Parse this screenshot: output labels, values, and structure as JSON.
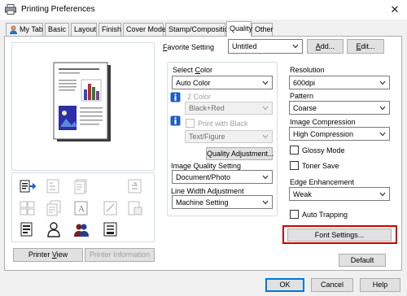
{
  "window": {
    "title": "Printing Preferences",
    "close_glyph": "✕"
  },
  "tabs": [
    {
      "label": "My Tab",
      "icon": "user-icon"
    },
    {
      "label": "Basic"
    },
    {
      "label": "Layout"
    },
    {
      "label": "Finish"
    },
    {
      "label": "Cover Mode"
    },
    {
      "label": "Stamp/Composition"
    },
    {
      "label": "Quality",
      "active": true
    },
    {
      "label": "Other"
    }
  ],
  "favorite": {
    "label_first": "F",
    "label_rest": "avorite Setting",
    "value": "Untitled",
    "add_first": "A",
    "add_rest": "dd...",
    "edit_first": "E",
    "edit_rest": "dit..."
  },
  "left_panel": {
    "preview_icons": [
      "printer-output-icon",
      "staple-icon",
      "booklet-icon",
      "stamp-icon",
      "grid-pages-icon",
      "copies-icon",
      "text-page-icon",
      "watermark-icon",
      "page-overlay-icon",
      "document-icon",
      "tray-icon",
      "color-icon",
      "user-auth-icon",
      "account-icon",
      "finisher-icon"
    ],
    "printer_view_first": "Printer ",
    "printer_view_u": "V",
    "printer_view_rest": "iew",
    "printer_info_label": "Printer Information"
  },
  "quality": {
    "select_color_label_pre": "Select ",
    "select_color_label_u": "C",
    "select_color_label_rest": "olor",
    "select_color_value": "Auto Color",
    "two_color_label": "2 Color",
    "two_color_value": "Black+Red",
    "print_with_black_label": "Print with Black",
    "print_with_black_value": "Text/Figure",
    "quality_adjustment_label": "Quality Adjustment...",
    "image_quality_label": "Image Quality Setting",
    "image_quality_value": "Document/Photo",
    "line_width_label": "Line Width Adjustment",
    "line_width_value": "Machine Setting"
  },
  "right_settings": {
    "resolution_label": "Resolution",
    "resolution_value": "600dpi",
    "pattern_label": "Pattern",
    "pattern_value": "Coarse",
    "compression_label": "Image Compression",
    "compression_value": "High Compression",
    "glossy_label": "Glossy Mode",
    "toner_save_label": "Toner Save",
    "edge_label": "Edge Enhancement",
    "edge_value": "Weak",
    "auto_trapping_label": "Auto Trapping",
    "font_settings_label": "Font Settings...",
    "default_label": "Default"
  },
  "footer": {
    "ok": "OK",
    "cancel": "Cancel",
    "help": "Help"
  },
  "colors": {
    "highlight": "#cc0000",
    "focus": "#0078d7",
    "panel_border": "#adadad"
  }
}
